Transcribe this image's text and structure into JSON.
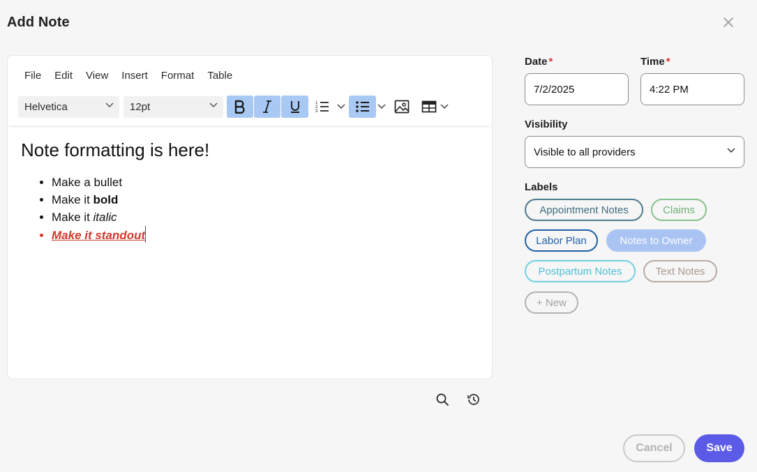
{
  "dialog": {
    "title": "Add Note"
  },
  "editor": {
    "menu": [
      "File",
      "Edit",
      "View",
      "Insert",
      "Format",
      "Table"
    ],
    "font_family": "Helvetica",
    "font_size": "12pt",
    "content": {
      "heading": "Note formatting is here!",
      "bullets": [
        {
          "prefix": "Make a bullet",
          "emphasis": ""
        },
        {
          "prefix": "Make it ",
          "emphasis": "bold"
        },
        {
          "prefix": "Make it ",
          "emphasis": "italic"
        },
        {
          "prefix": "Make it standout",
          "emphasis": ""
        }
      ],
      "standout_color": "#d03a2e"
    }
  },
  "form": {
    "date_label": "Date",
    "date_value": "7/2/2025",
    "time_label": "Time",
    "time_value": "4:22 PM",
    "required_mark": "*",
    "visibility_label": "Visibility",
    "visibility_value": "Visible to all providers",
    "labels_label": "Labels",
    "labels": [
      {
        "text": "Appointment Notes",
        "color": "#4a7a8c"
      },
      {
        "text": "Claims",
        "color": "#7dbb85"
      },
      {
        "text": "Labor Plan",
        "color": "#1f5fa8"
      },
      {
        "text": "Notes to Owner",
        "color": "#a9c3f2"
      },
      {
        "text": "Postpartum Notes",
        "color": "#5cc3d9"
      },
      {
        "text": "Text Notes",
        "color": "#b5a39c"
      },
      {
        "text": "+ New",
        "color": "#a8a8a8"
      }
    ]
  },
  "actions": {
    "cancel": "Cancel",
    "save": "Save",
    "save_color": "#5b5be8"
  }
}
